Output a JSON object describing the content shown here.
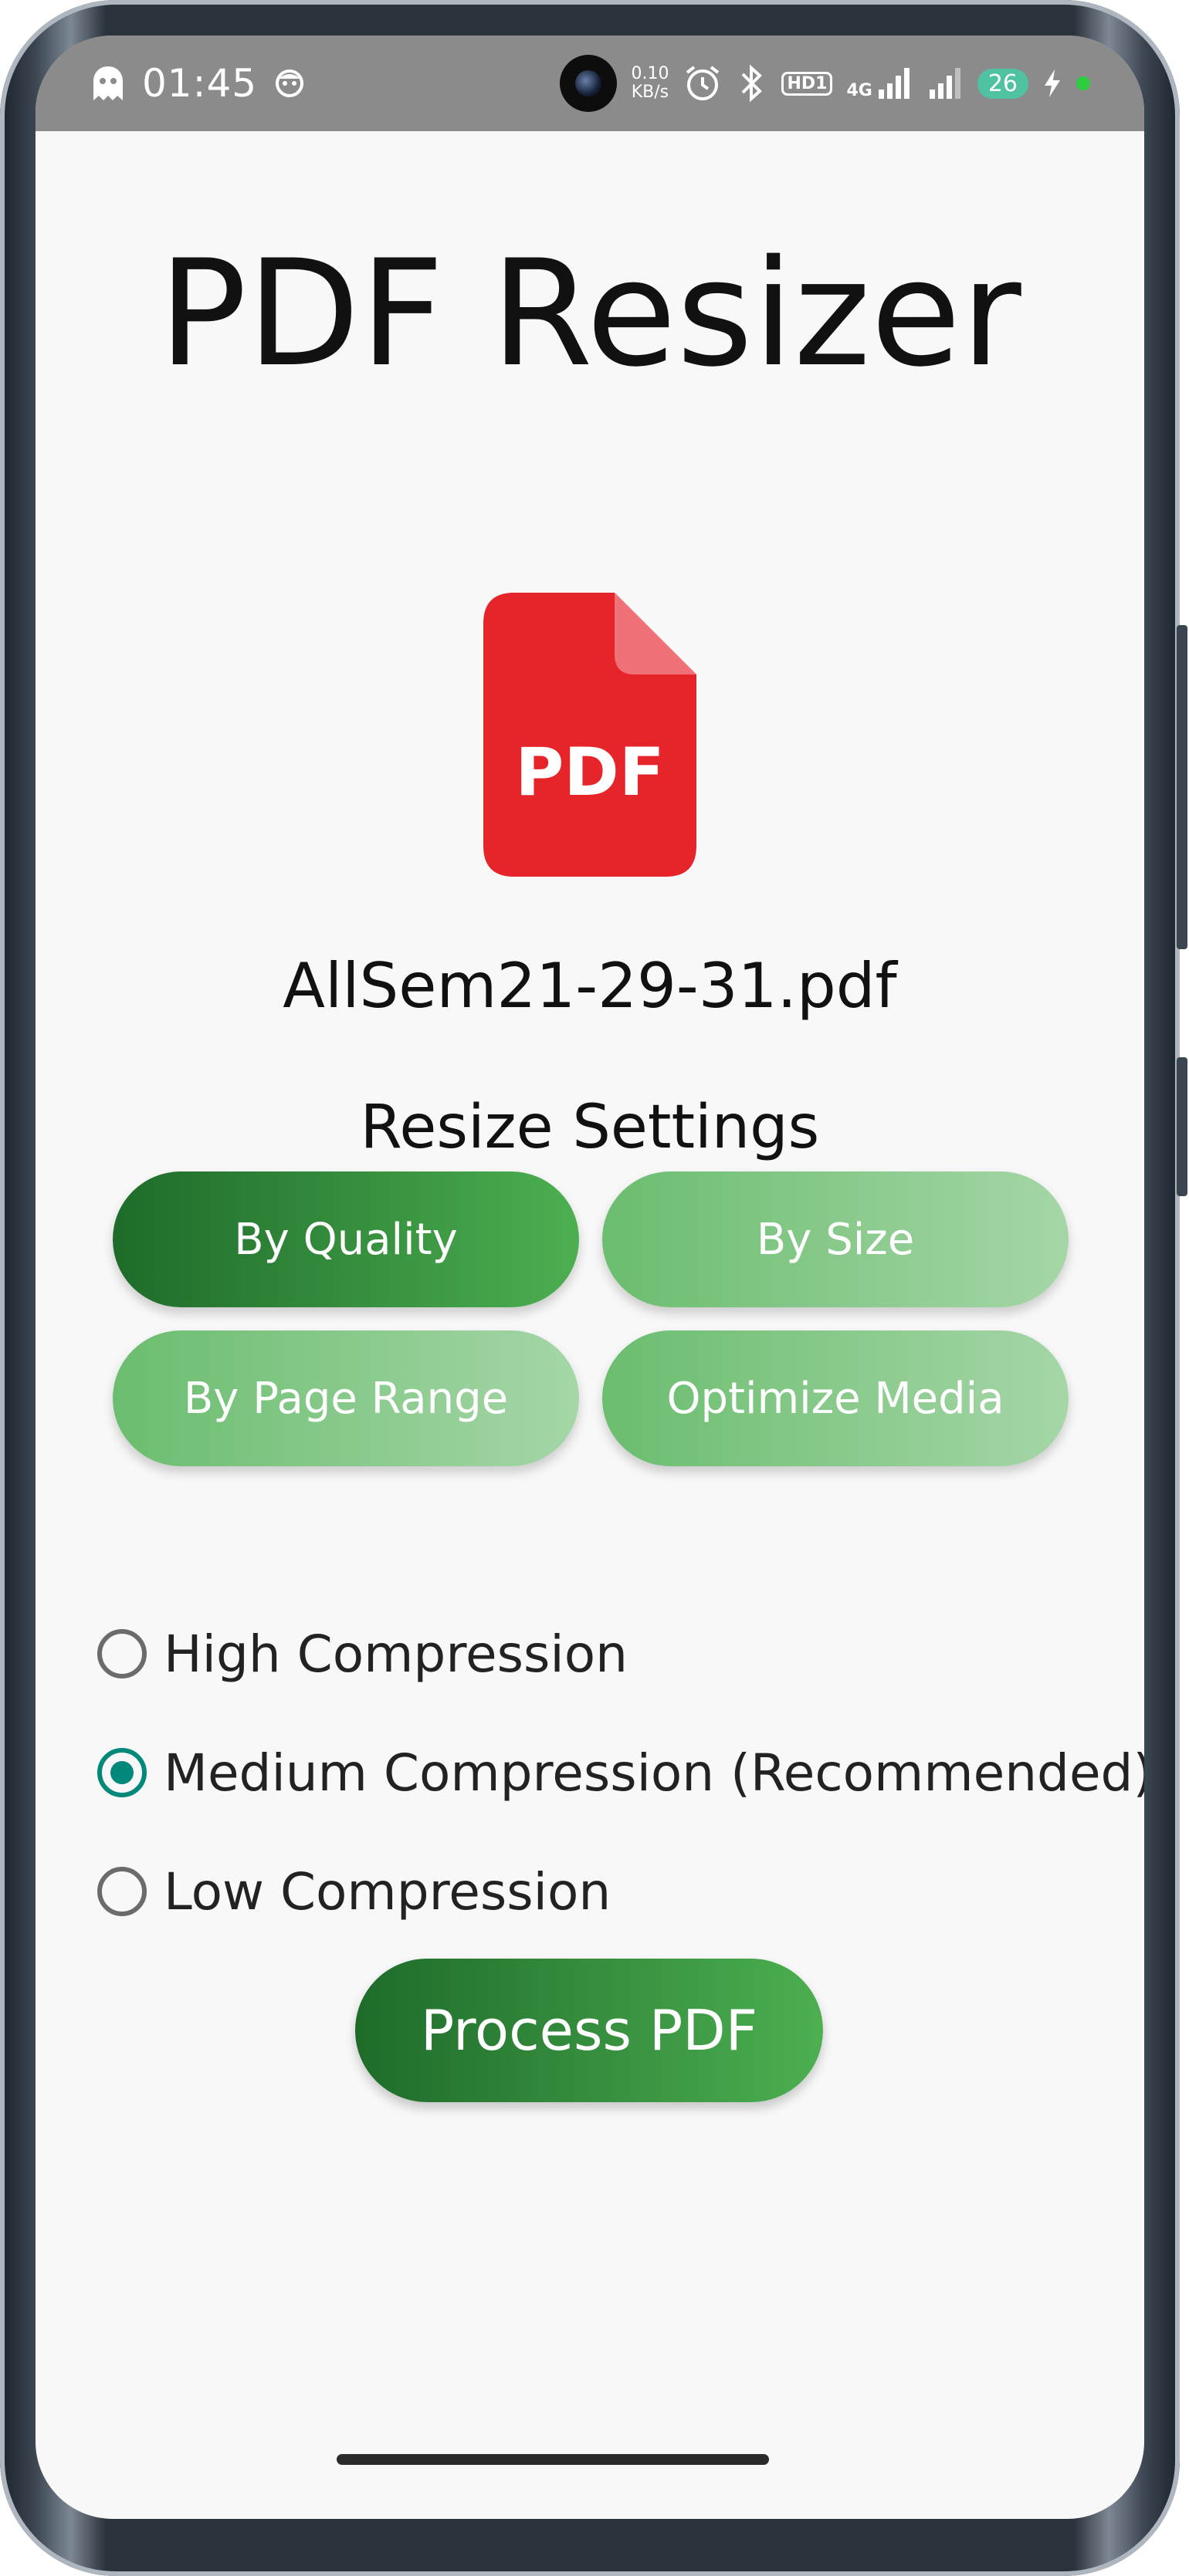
{
  "statusbar": {
    "time": "01:45",
    "net_speed_value": "0.10",
    "net_speed_unit": "KB/s",
    "hd_label": "HD1",
    "network_type": "4G",
    "battery": "26"
  },
  "app": {
    "title": "PDF Resizer",
    "file_icon_label": "PDF",
    "file_name": "AllSem21-29-31.pdf",
    "section_title": "Resize Settings"
  },
  "modes": [
    {
      "label": "By Quality",
      "active": true
    },
    {
      "label": "By Size",
      "active": false
    },
    {
      "label": "By Page Range",
      "active": false
    },
    {
      "label": "Optimize Media",
      "active": false
    }
  ],
  "compression_options": [
    {
      "label": "High Compression",
      "selected": false
    },
    {
      "label": "Medium Compression (Recommended)",
      "selected": true
    },
    {
      "label": "Low Compression",
      "selected": false
    }
  ],
  "process_button": "Process PDF",
  "colors": {
    "active_green": "#2e7d32",
    "inactive_green": "#81c784",
    "radio_teal": "#00897b",
    "pdf_red": "#e5252a"
  }
}
